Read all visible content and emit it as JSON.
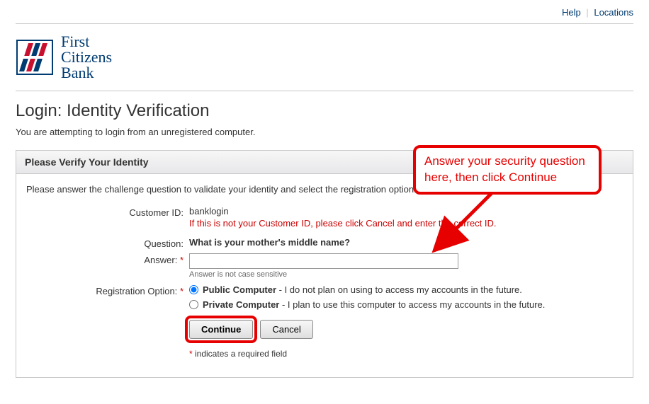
{
  "topnav": {
    "help": "Help",
    "locations": "Locations"
  },
  "logo": {
    "line1": "First",
    "line2": "Citizens",
    "line3": "Bank"
  },
  "page_title": "Login: Identity Verification",
  "page_subtitle": "You are attempting to login from an unregistered computer.",
  "panel": {
    "header": "Please Verify Your Identity",
    "instruction": "Please answer the challenge question to validate your identity and select the registration option.",
    "customer_id_label": "Customer ID:",
    "customer_id_value": "banklogin",
    "customer_id_warning": "If this is not your Customer ID, please click Cancel and enter the correct ID.",
    "question_label": "Question:",
    "question_value": "What is your mother's middle name?",
    "answer_label": "Answer:",
    "answer_hint": "Answer is not case sensitive",
    "reg_label": "Registration Option:",
    "reg_public_bold": "Public Computer",
    "reg_public_rest": " - I do not plan on using to access my accounts in the future.",
    "reg_private_bold": "Private Computer",
    "reg_private_rest": " - I plan to use this computer to access my accounts in the future.",
    "continue": "Continue",
    "cancel": "Cancel",
    "required_note": " indicates a required field"
  },
  "callout": {
    "text": "Answer your security question here, then click Continue"
  }
}
